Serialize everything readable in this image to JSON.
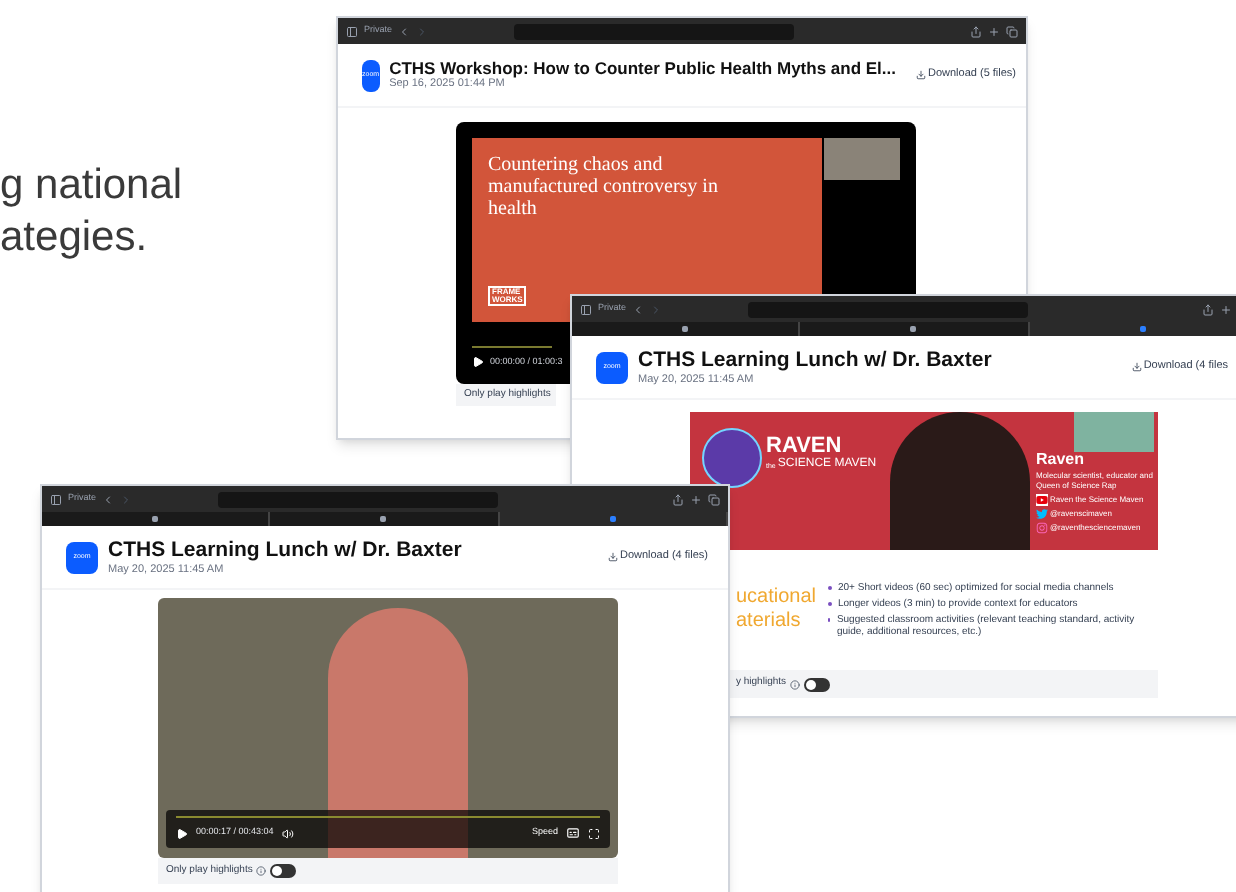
{
  "slide_text": [
    "g national",
    "ategies."
  ],
  "windows": [
    {
      "kind": "slide",
      "private_label": "Private",
      "logo": "zoom",
      "title": "CTHS Workshop: How to Counter Public Health Myths and El...",
      "date": "Sep 16, 2025 01:44 PM",
      "download": "Download (5 files)",
      "slide": {
        "heading": "Countering chaos and manufactured controversy in health",
        "logo_lines": [
          "FRAME",
          "WORKS"
        ]
      },
      "time": "00:00:00 / 01:00:3",
      "highlights": "Only play highlights"
    },
    {
      "kind": "banner",
      "private_label": "Private",
      "tabs": [
        {
          "selected": false
        },
        {
          "selected": false
        },
        {
          "selected": true
        }
      ],
      "logo": "zoom",
      "title": "CTHS Learning Lunch w/ Dr. Baxter",
      "date": "May 20, 2025 11:45 AM",
      "download": "Download (4 files",
      "banner": {
        "brand": "RAVEN",
        "brand_tag": "the",
        "brand_sub": "SCIENCE MAVEN",
        "name": "Raven",
        "bio": "Molecular scientist, educator and Queen of Science Rap",
        "socials": [
          {
            "kind": "youtube",
            "handle": "Raven the Science Maven"
          },
          {
            "kind": "twitter",
            "handle": "@ravenscimaven"
          },
          {
            "kind": "instagram",
            "handle": "@raventhesciencemaven"
          }
        ]
      },
      "materials": [
        "ucational",
        "aterials"
      ],
      "bullets": [
        "20+ Short videos (60 sec) optimized for social media channels",
        "Longer videos (3 min) to provide context for educators",
        "Suggested classroom activities (relevant teaching standard, activity guide, additional resources, etc.)"
      ],
      "highlights": "y highlights",
      "toggle_on": false
    },
    {
      "kind": "camera",
      "private_label": "Private",
      "tabs": [
        {
          "selected": false
        },
        {
          "selected": false
        },
        {
          "selected": true
        }
      ],
      "logo": "zoom",
      "title": "CTHS Learning Lunch w/ Dr. Baxter",
      "date": "May 20, 2025 11:45 AM",
      "download": "Download (4 files)",
      "time": "00:00:17 / 00:43:04",
      "speed": "Speed",
      "highlights": "Only play highlights",
      "toggle_on": false
    }
  ]
}
